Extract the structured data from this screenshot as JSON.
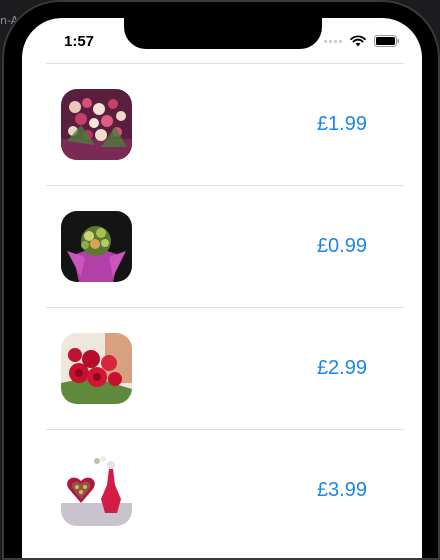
{
  "window": {
    "partial_label": "n-A"
  },
  "status_bar": {
    "time": "1:57"
  },
  "products": [
    {
      "image_icon": "flower-bouquet-mixed-icon",
      "price": "£1.99"
    },
    {
      "image_icon": "potted-flowers-icon",
      "price": "£0.99"
    },
    {
      "image_icon": "red-roses-icon",
      "price": "£2.99"
    },
    {
      "image_icon": "heart-chocolates-icon",
      "price": "£3.99"
    }
  ],
  "colors": {
    "price": "#1b87e6",
    "divider": "#e0e0e4",
    "background": "#ffffff"
  }
}
